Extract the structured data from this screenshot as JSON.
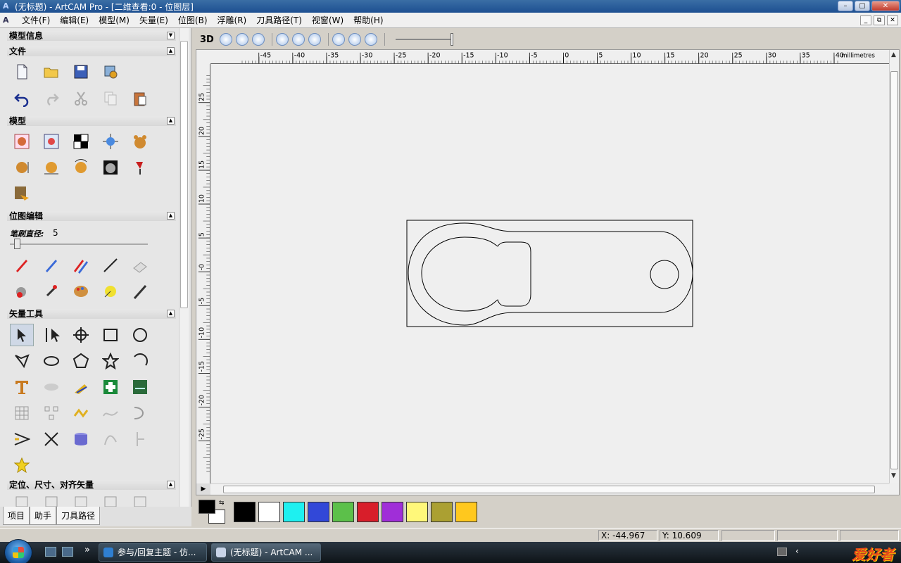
{
  "window": {
    "title": "(无标题) - ArtCAM Pro - [二维查看:0 - 位图层]",
    "controls": {
      "minimize": "–",
      "restore": "▢",
      "close": "✕"
    }
  },
  "menu": {
    "items": [
      "文件(F)",
      "编辑(E)",
      "模型(M)",
      "矢量(E)",
      "位图(B)",
      "浮雕(R)",
      "刀具路径(T)",
      "视窗(W)",
      "帮助(H)"
    ],
    "doc_controls": {
      "minimize": "_",
      "restore": "⧉",
      "close": "✕"
    }
  },
  "left_panel": {
    "sections": {
      "model_info": "模型信息",
      "file": "文件",
      "model": "模型",
      "bitmap_edit": "位图编辑",
      "vector_tools": "矢量工具",
      "align": "定位、尺寸、对齐矢量"
    },
    "toggle_down": "▼",
    "toggle_up": "▲",
    "brush_diameter_label": "笔刷直径:",
    "brush_diameter_value": "5",
    "bottom_tabs": [
      "项目",
      "助手",
      "刀具路径"
    ]
  },
  "view_toolbar": {
    "mode_3d": "3D"
  },
  "rulers": {
    "h_ticks": [
      "-45",
      "-40",
      "-35",
      "-30",
      "-25",
      "-20",
      "-15",
      "-10",
      "-5",
      "0",
      "5",
      "10",
      "15",
      "20",
      "25",
      "30",
      "35",
      "40"
    ],
    "units": "millimetres",
    "v_ticks": [
      "25",
      "20",
      "15",
      "10",
      "5",
      "-0",
      "-5",
      "-10",
      "-15",
      "-20",
      "-25"
    ]
  },
  "palette": {
    "colors": [
      "#000000",
      "#ffffff",
      "#1ef0f0",
      "#3248d8",
      "#5cc04a",
      "#d81e2a",
      "#a02ed8",
      "#fff87a",
      "#aba032",
      "#ffc81e"
    ]
  },
  "status": {
    "x": "X: -44.967",
    "y": "Y: 10.609"
  },
  "taskbar": {
    "more": "»",
    "windows": [
      {
        "label": "参与/回复主题 - 仿...",
        "icon_color": "#2f7fd0"
      },
      {
        "label": "(无标题) - ArtCAM ...",
        "icon_color": "#c8d4e8"
      }
    ],
    "watermark": "爱好者"
  }
}
